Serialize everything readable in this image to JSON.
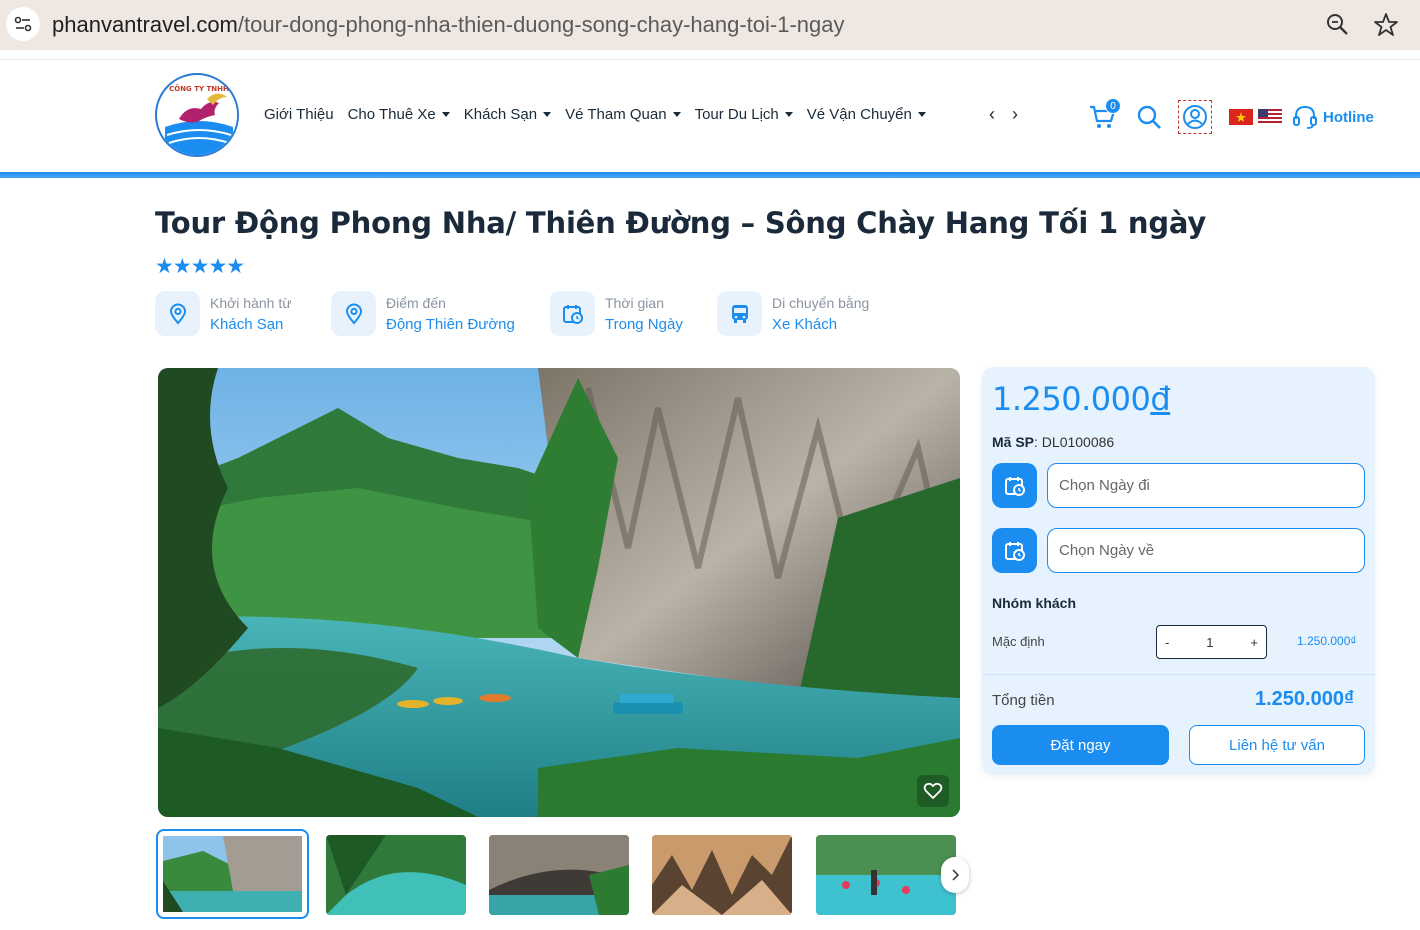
{
  "browser": {
    "url_domain": "phanvantravel.com",
    "url_path": "/tour-dong-phong-nha-thien-duong-song-chay-hang-toi-1-ngay",
    "icons": [
      "site-settings-icon",
      "zoom-icon",
      "bookmark-star-icon"
    ]
  },
  "header": {
    "logo_alt": "Công ty TNHH Phan Văn",
    "nav": [
      {
        "label": "Giới Thiệu",
        "dropdown": false
      },
      {
        "label": "Cho Thuê Xe",
        "dropdown": true
      },
      {
        "label": "Khách Sạn",
        "dropdown": true
      },
      {
        "label": "Vé Tham Quan",
        "dropdown": true
      },
      {
        "label": "Tour Du Lịch",
        "dropdown": true
      },
      {
        "label": "Vé Vận Chuyển",
        "dropdown": true
      }
    ],
    "nav_arrows": "‹ ›",
    "cart_count": "0",
    "hotline": "Hotline",
    "accent": "#1b8df0"
  },
  "tour": {
    "title": "Tour Động Phong Nha/ Thiên Đường – Sông Chày Hang Tối 1 ngày",
    "stars": "★★★★★",
    "rating": 5,
    "info": [
      {
        "label": "Khởi hành từ",
        "value": "Khách Sạn",
        "icon": "location-pin-icon"
      },
      {
        "label": "Điểm đến",
        "value": "Động Thiên Đường",
        "icon": "location-pin-icon"
      },
      {
        "label": "Thời gian",
        "value": "Trong Ngày",
        "icon": "calendar-clock-icon"
      },
      {
        "label": "Di chuyển bằng",
        "value": "Xe Khách",
        "icon": "bus-icon"
      }
    ]
  },
  "booking": {
    "price_number": "1.250.000",
    "price_currency": "đ",
    "sku_label": "Mã SP",
    "sku_value": ": DL0100086",
    "depart_placeholder": "Chọn Ngày đi",
    "return_placeholder": "Chọn Ngày về",
    "group_title": "Nhóm khách",
    "default_label": "Mặc định",
    "minus": "-",
    "quantity": "1",
    "plus": "+",
    "unit_price": "1.250.000₫",
    "total_label": "Tổng tiền",
    "total_value": "1.250.000₫",
    "book_label": "Đặt ngay",
    "contact_label": "Liên hệ tư vấn"
  }
}
